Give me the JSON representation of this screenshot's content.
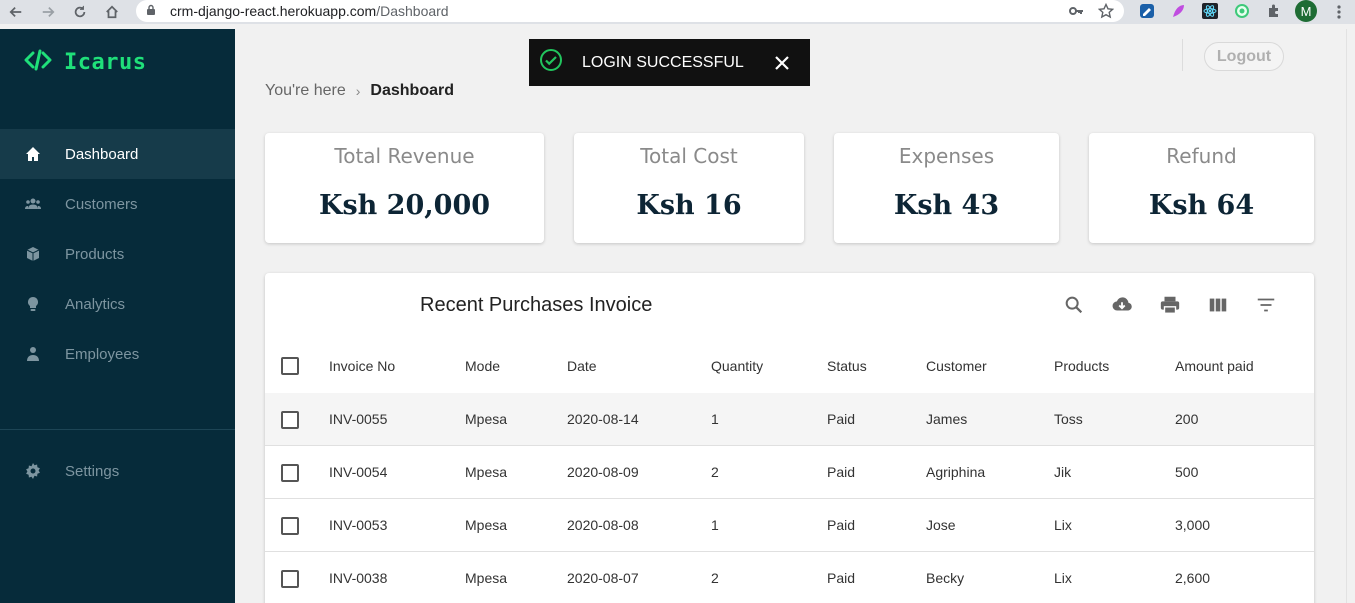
{
  "browser": {
    "url_host": "crm-django-react.herokuapp.com",
    "url_path": "/Dashboard",
    "avatar_letter": "M"
  },
  "sidebar": {
    "brand": "Icarus",
    "items": [
      {
        "label": "Dashboard",
        "icon": "home-icon",
        "active": true
      },
      {
        "label": "Customers",
        "icon": "people-icon",
        "active": false
      },
      {
        "label": "Products",
        "icon": "box-icon",
        "active": false
      },
      {
        "label": "Analytics",
        "icon": "lightbulb-icon",
        "active": false
      },
      {
        "label": "Employees",
        "icon": "person-icon",
        "active": false
      }
    ],
    "settings": {
      "label": "Settings",
      "icon": "gear-icon"
    }
  },
  "topbar": {
    "logout_label": "Logout"
  },
  "toast": {
    "message": "LOGIN SUCCESSFUL"
  },
  "breadcrumb": {
    "prefix": "You're here",
    "separator": "›",
    "current": "Dashboard"
  },
  "stats": [
    {
      "title": "Total Revenue",
      "value": "Ksh 20,000"
    },
    {
      "title": "Total Cost",
      "value": "Ksh 16"
    },
    {
      "title": "Expenses",
      "value": "Ksh 43"
    },
    {
      "title": "Refund",
      "value": "Ksh 64"
    }
  ],
  "table": {
    "title": "Recent Purchases Invoice",
    "columns": [
      "Invoice No",
      "Mode",
      "Date",
      "Quantity",
      "Status",
      "Customer",
      "Products",
      "Amount paid"
    ],
    "rows": [
      [
        "INV-0055",
        "Mpesa",
        "2020-08-14",
        "1",
        "Paid",
        "James",
        "Toss",
        "200"
      ],
      [
        "INV-0054",
        "Mpesa",
        "2020-08-09",
        "2",
        "Paid",
        "Agriphina",
        "Jik",
        "500"
      ],
      [
        "INV-0053",
        "Mpesa",
        "2020-08-08",
        "1",
        "Paid",
        "Jose",
        "Lix",
        "3,000"
      ],
      [
        "INV-0038",
        "Mpesa",
        "2020-08-07",
        "2",
        "Paid",
        "Becky",
        "Lix",
        "2,600"
      ]
    ]
  },
  "colors": {
    "sidebar_bg": "#062b3a",
    "brand_green": "#1fe07a",
    "toast_bg": "#111111",
    "toast_check": "#22c55e"
  }
}
